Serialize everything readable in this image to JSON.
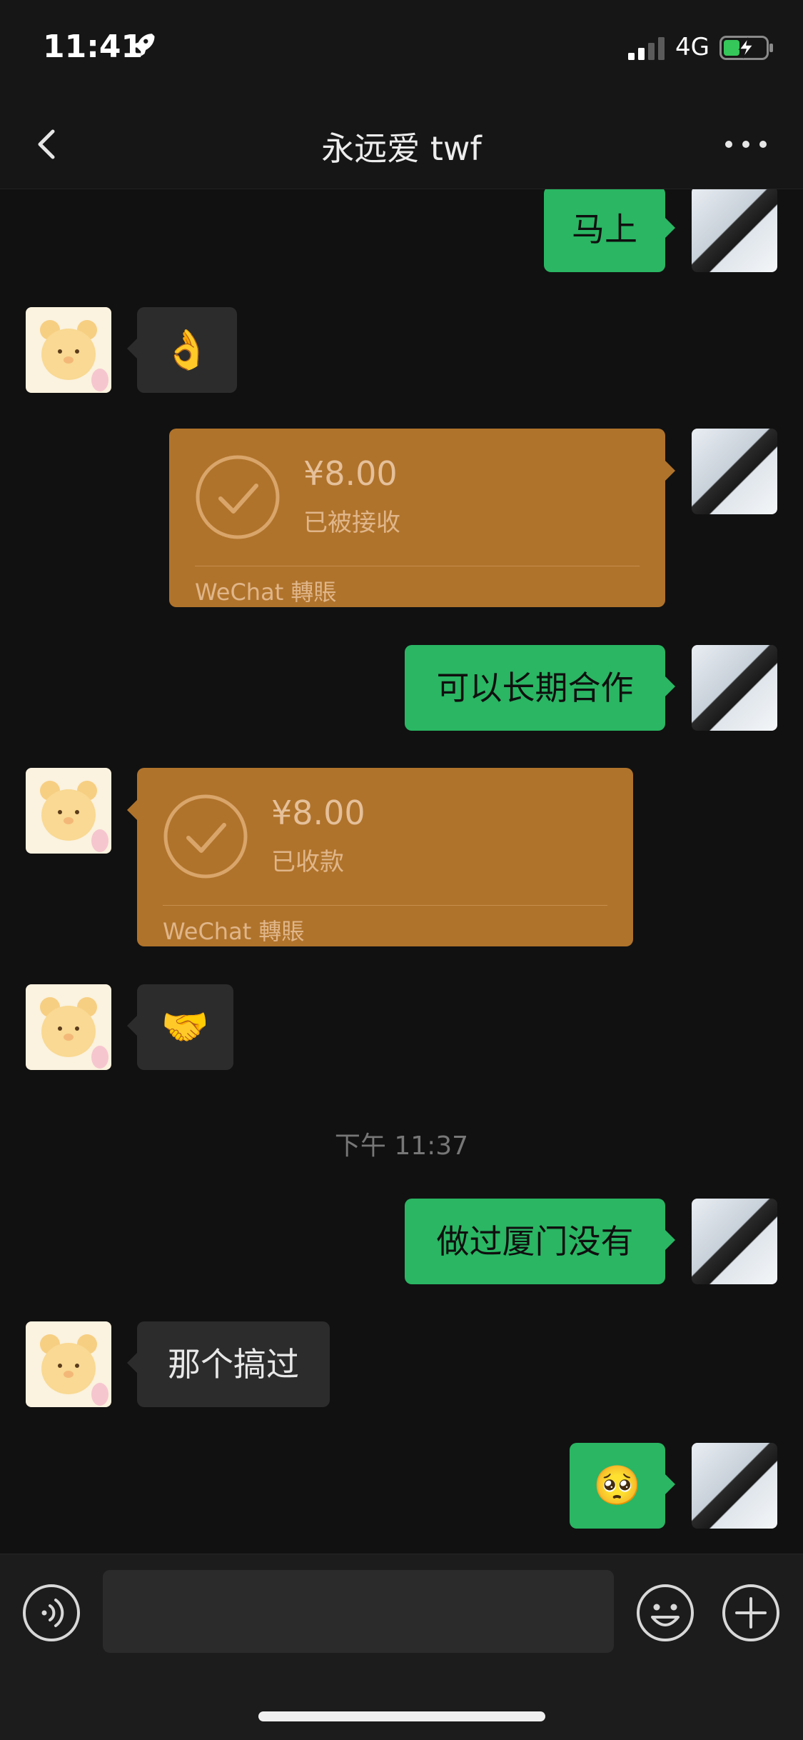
{
  "status_bar": {
    "time": "11:41",
    "network": "4G",
    "icons": [
      "rocket-icon",
      "signal-icon",
      "battery-icon"
    ]
  },
  "nav": {
    "title": "永远爱 twf",
    "icons": [
      "back-icon",
      "more-icon"
    ]
  },
  "messages": [
    {
      "direction": "out",
      "type": "text",
      "text": "马上"
    },
    {
      "direction": "in",
      "type": "text",
      "text": "👌"
    },
    {
      "direction": "out",
      "type": "transfer",
      "amount": "¥8.00",
      "status": "已被接收",
      "footer": "WeChat 轉賬"
    },
    {
      "direction": "out",
      "type": "text",
      "text": "可以长期合作"
    },
    {
      "direction": "in",
      "type": "transfer",
      "amount": "¥8.00",
      "status": "已收款",
      "footer": "WeChat 轉賬"
    },
    {
      "direction": "in",
      "type": "text",
      "text": "🤝"
    },
    {
      "direction": "out",
      "type": "text",
      "text": "做过厦门没有"
    },
    {
      "direction": "in",
      "type": "text",
      "text": "那个搞过"
    },
    {
      "direction": "out",
      "type": "text",
      "text": "🥺"
    }
  ],
  "timestamp": "下午 11:37",
  "input_bar": {
    "value": "",
    "placeholder": "",
    "icons": [
      "voice-icon",
      "emoji-icon",
      "plus-icon"
    ]
  },
  "colors": {
    "background": "#111111",
    "bubble_out": "#2ab663",
    "bubble_in": "#2c2c2c",
    "transfer": "#b0732b"
  }
}
